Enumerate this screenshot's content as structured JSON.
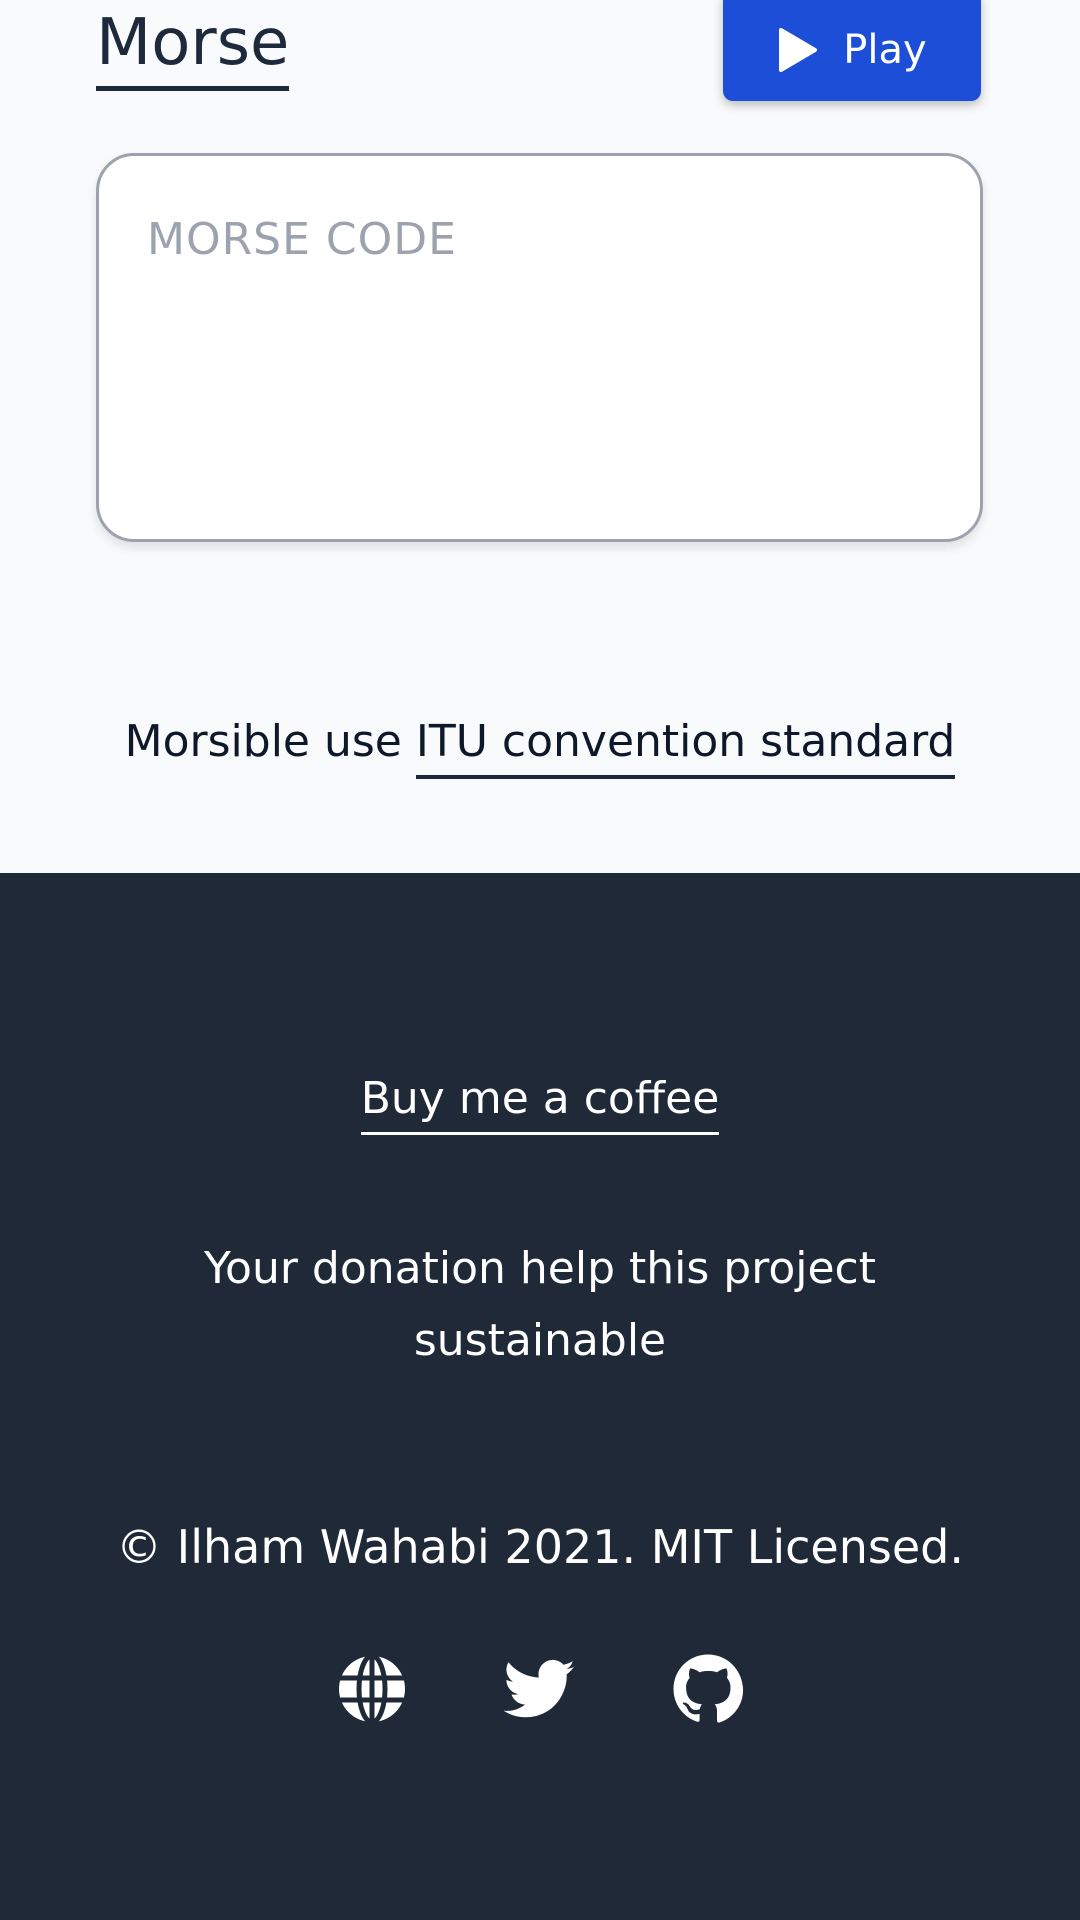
{
  "header": {
    "title": "Morse",
    "play_label": "Play"
  },
  "morse_input": {
    "placeholder": "MORSE CODE",
    "value": ""
  },
  "info": {
    "prefix": "Morsible use ",
    "link_text": "ITU convention standard"
  },
  "footer": {
    "coffee_link": "Buy me a coffee",
    "donation_text": "Your donation help this project sustainable",
    "copyright": "© Ilham Wahabi 2021. MIT Licensed.",
    "social_icons": [
      "globe-icon",
      "twitter-icon",
      "github-icon"
    ]
  },
  "colors": {
    "accent": "#1d4ed8",
    "footer_bg": "#1f2937",
    "page_bg": "#f8fafc",
    "text_dark": "#1e293b",
    "placeholder": "#9ca3af"
  }
}
